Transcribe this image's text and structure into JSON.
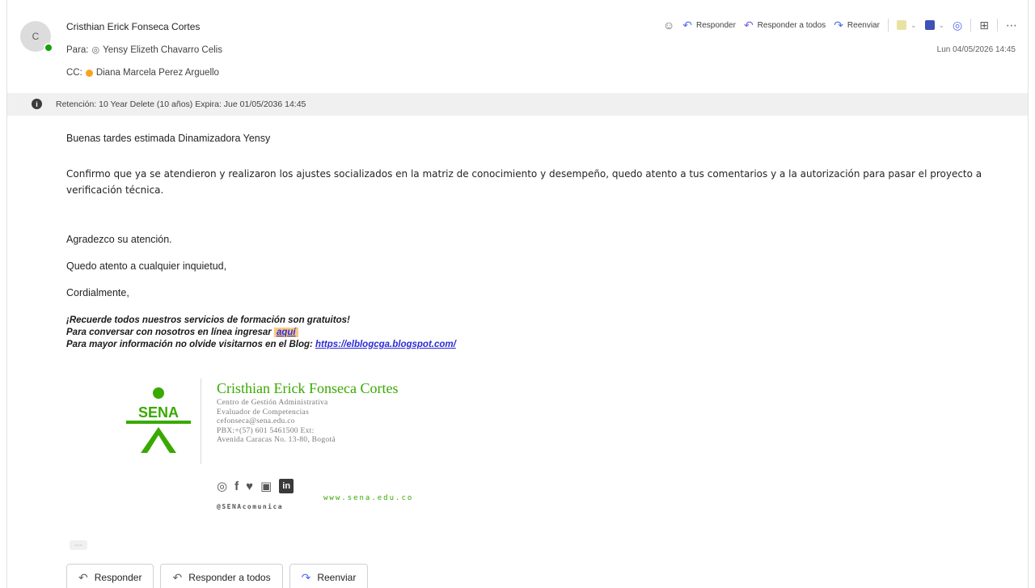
{
  "header": {
    "avatar_initial": "C",
    "sender": "Cristhian Erick Fonseca Cortes",
    "to_label": "Para:",
    "to_recipient": "Yensy Elizeth Chavarro Celis",
    "cc_label": "CC:",
    "cc_recipient": "Diana Marcela Perez Arguello",
    "date": "Lun 04/05/2026 14:45"
  },
  "toolbar": {
    "reply": "Responder",
    "reply_all": "Responder a todos",
    "forward": "Reenviar"
  },
  "retention": {
    "text": "Retención: 10 Year Delete (10 años) Expira: Jue 01/05/2036 14:45"
  },
  "body": {
    "greeting": "Buenas tardes estimada Dinamizadora Yensy",
    "paragraph": "Confirmo que ya se atendieron y realizaron los ajustes socializados en la matriz de conocimiento y desempeño, quedo atento a tus comentarios y a la autorización para pasar el proyecto a verificación técnica.",
    "thanks": "Agradezco su atención.",
    "attentive": "Quedo atento a cualquier inquietud,",
    "closing": "Cordialmente,",
    "promo_line1": "¡Recuerde todos nuestros servicios de formación son gratuitos!",
    "promo_line2": "Para conversar con nosotros en línea ingresar",
    "promo_link_aqui": "aquí",
    "promo_line3": "Para mayor información no olvide visitarnos en el Blog:",
    "blog_link": "https://elblogcga.blogspot.com/"
  },
  "signature": {
    "logo_text": "SENA",
    "name": "Cristhian Erick Fonseca Cortes",
    "line1": "Centro de Gestión Administrativa",
    "line2": "Evaluador de Competencias",
    "line3": "cefonseca@sena.edu.co",
    "line4": "PBX:+(57) 601 5461500 Ext:",
    "line5": "Avenida Caracas No. 13-80, Bogotá",
    "social_handle": "@SENAcomunica",
    "website": "www.sena.edu.co",
    "icons": [
      "instagram-icon",
      "facebook-icon",
      "twitter-icon",
      "youtube-icon",
      "linkedin-icon"
    ]
  },
  "bottom_actions": {
    "reply": "Responder",
    "reply_all": "Responder a todos",
    "forward": "Reenviar"
  },
  "colors": {
    "accent_green": "#39a900",
    "link_blue": "#2b2bd6",
    "presence_green": "#13a10e",
    "cc_badge": "#f7a41d"
  }
}
